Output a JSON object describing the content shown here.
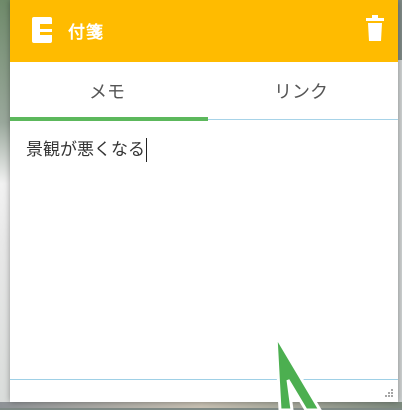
{
  "header": {
    "title": "付箋",
    "app_icon": "note-icon",
    "delete_icon": "trash-icon",
    "color": "#ffbb00"
  },
  "tabs": [
    {
      "label": "メモ",
      "active": true
    },
    {
      "label": "リンク",
      "active": false
    }
  ],
  "memo": {
    "text": "景観が悪くなる"
  },
  "colors": {
    "active_tab_indicator": "#5cb85c",
    "divider": "#a7d3e8",
    "arrow": "#4caf50"
  }
}
